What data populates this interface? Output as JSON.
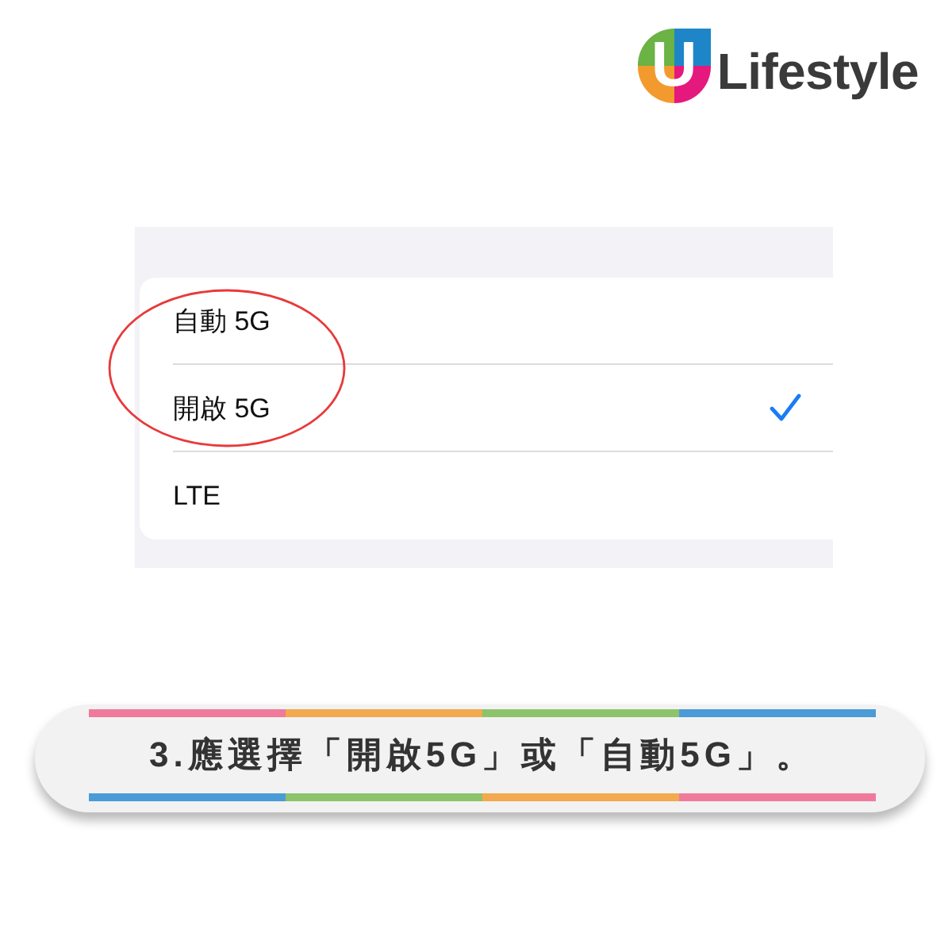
{
  "logo": {
    "mark": "U",
    "name": "Lifestyle"
  },
  "screenshot": {
    "options": [
      {
        "label": "自動 5G",
        "selected": false,
        "circled": true
      },
      {
        "label": "開啟 5G",
        "selected": true,
        "circled": true
      },
      {
        "label": "LTE",
        "selected": false,
        "circled": false
      }
    ]
  },
  "caption": "3.應選擇「開啟5G」或「自動5G」。"
}
